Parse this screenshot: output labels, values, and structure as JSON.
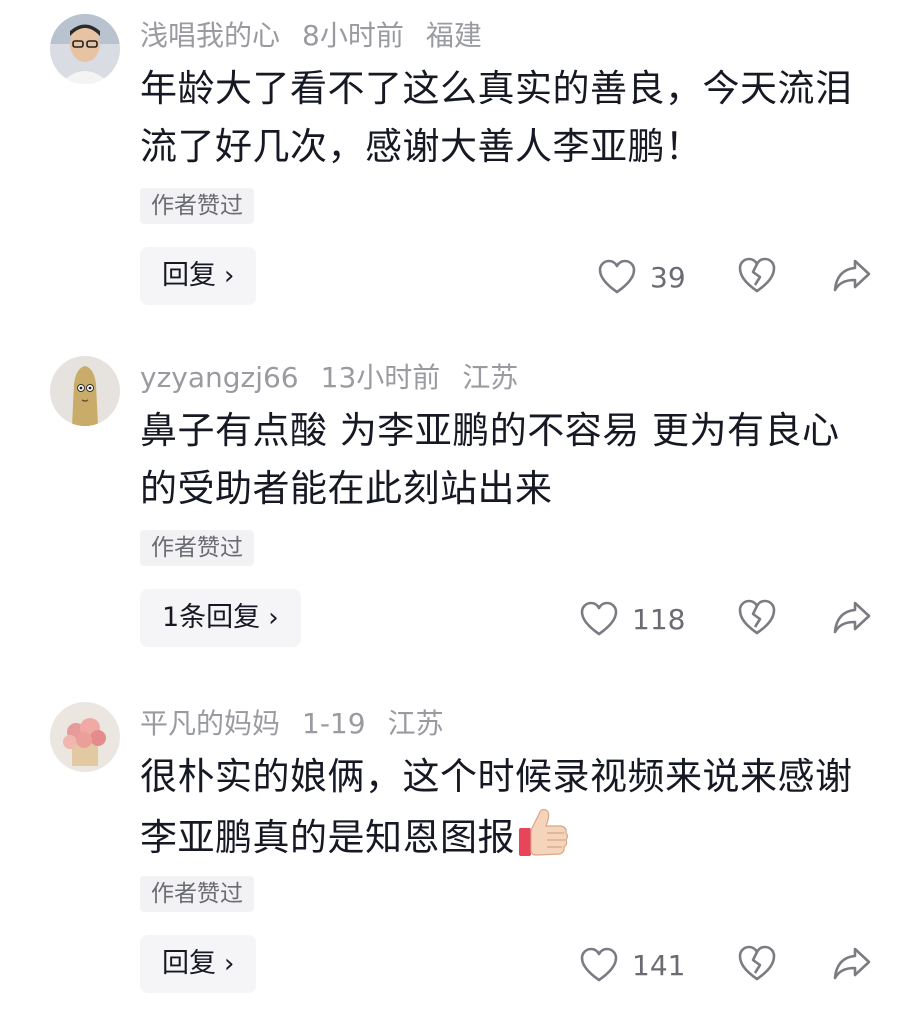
{
  "comments": [
    {
      "username": "浅唱我的心",
      "time": "8小时前",
      "location": "福建",
      "text": "年龄大了看不了这么真实的善良，今天流泪流了好几次，感谢大善人李亚鹏！",
      "badge": "作者赞过",
      "reply_label": "回复",
      "likes": "39"
    },
    {
      "username": "yzyangzj66",
      "time": "13小时前",
      "location": "江苏",
      "text": "鼻子有点酸 为李亚鹏的不容易 更为有良心的受助者能在此刻站出来",
      "badge": "作者赞过",
      "reply_label": "1条回复",
      "likes": "118"
    },
    {
      "username": "平凡的妈妈",
      "time": "1-19",
      "location": "江苏",
      "text": "很朴实的娘俩，这个时候录视频来说来感谢李亚鹏真的是知恩图报",
      "emoji": "thumbs-up-icon",
      "badge": "作者赞过",
      "reply_label": "回复",
      "likes": "141"
    }
  ],
  "icons": {
    "like": "heart-outline-icon",
    "dislike": "broken-heart-icon",
    "share": "share-arrow-icon"
  },
  "colors": {
    "meta": "#9a9ba1",
    "text": "#161823",
    "icon": "#7b7c82",
    "badge_bg": "#f2f2f4",
    "reply_bg": "#f5f5f7"
  }
}
